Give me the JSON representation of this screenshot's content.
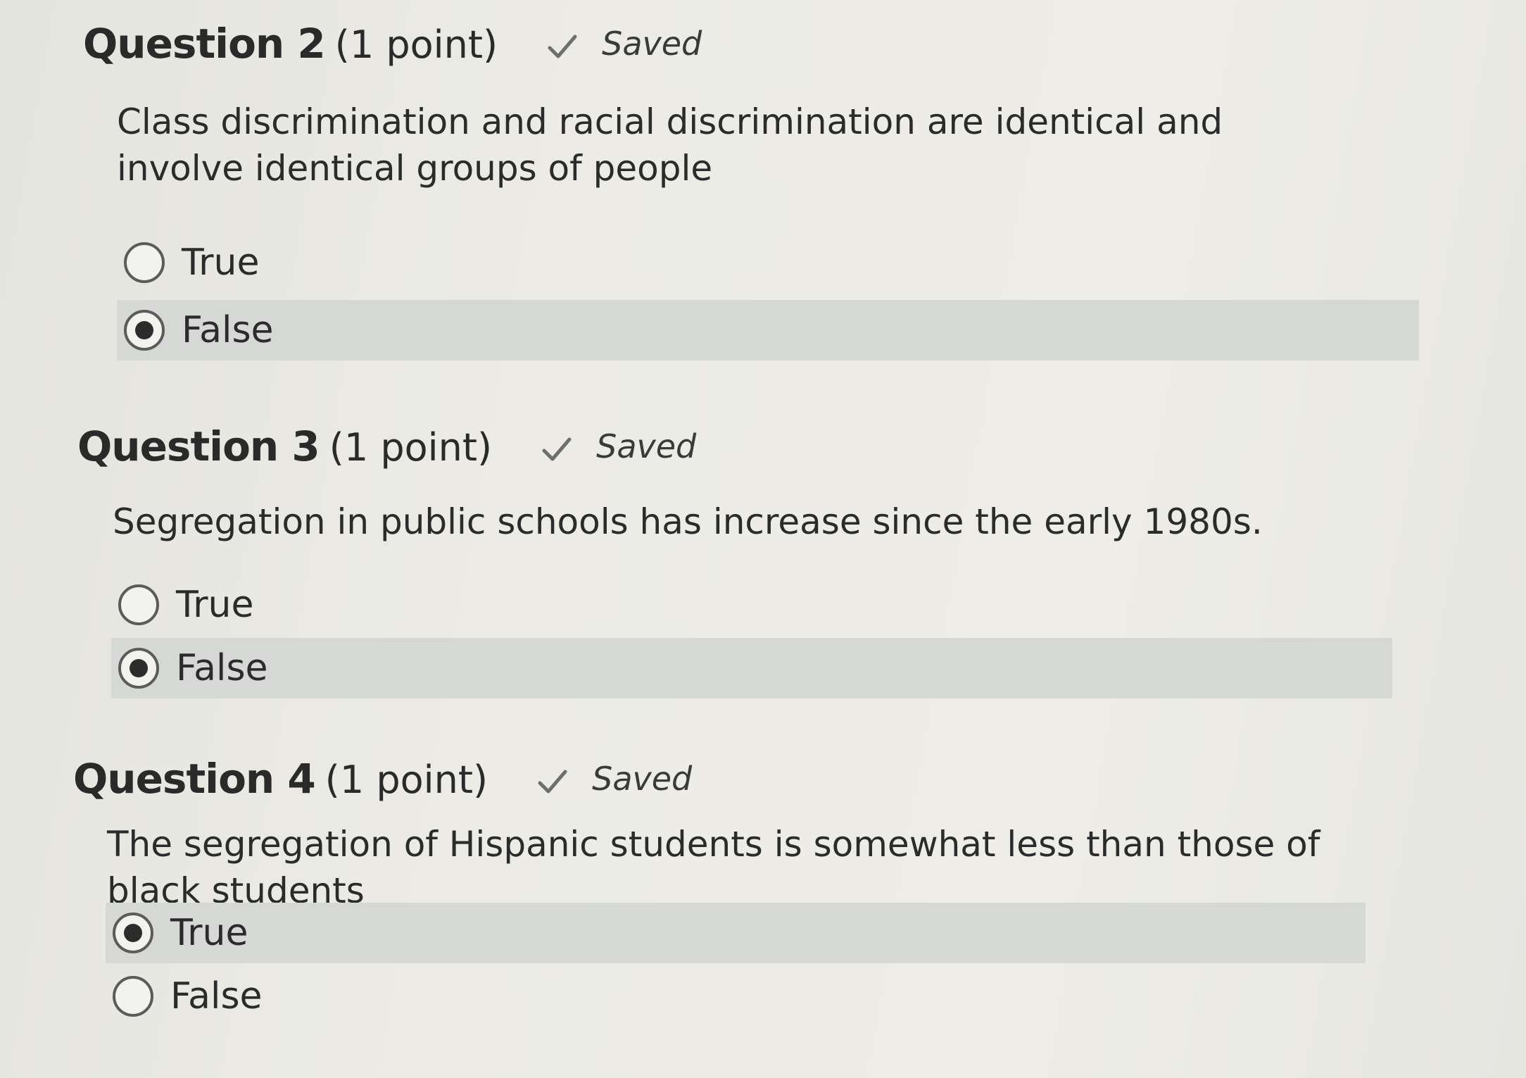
{
  "questions": [
    {
      "title": "Question 2",
      "points": "(1 point)",
      "status": "Saved",
      "status_icon": "check-icon",
      "text": "Class discrimination and racial discrimination are identical and involve identical groups of people",
      "options": [
        {
          "label": "True",
          "selected": false
        },
        {
          "label": "False",
          "selected": true
        }
      ]
    },
    {
      "title": "Question 3",
      "points": "(1 point)",
      "status": "Saved",
      "status_icon": "check-icon",
      "text": "Segregation in public schools has increase since the early 1980s.",
      "options": [
        {
          "label": "True",
          "selected": false
        },
        {
          "label": "False",
          "selected": true
        }
      ]
    },
    {
      "title": "Question 4",
      "points": "(1 point)",
      "status": "Saved",
      "status_icon": "check-icon",
      "text": "The segregation of Hispanic students is somewhat less than those of black students",
      "options": [
        {
          "label": "True",
          "selected": true
        },
        {
          "label": "False",
          "selected": false
        }
      ]
    }
  ],
  "colors": {
    "selected_row": "#d6d8d6",
    "text": "#2b2b2b",
    "radio_border": "#5b5b5b"
  }
}
